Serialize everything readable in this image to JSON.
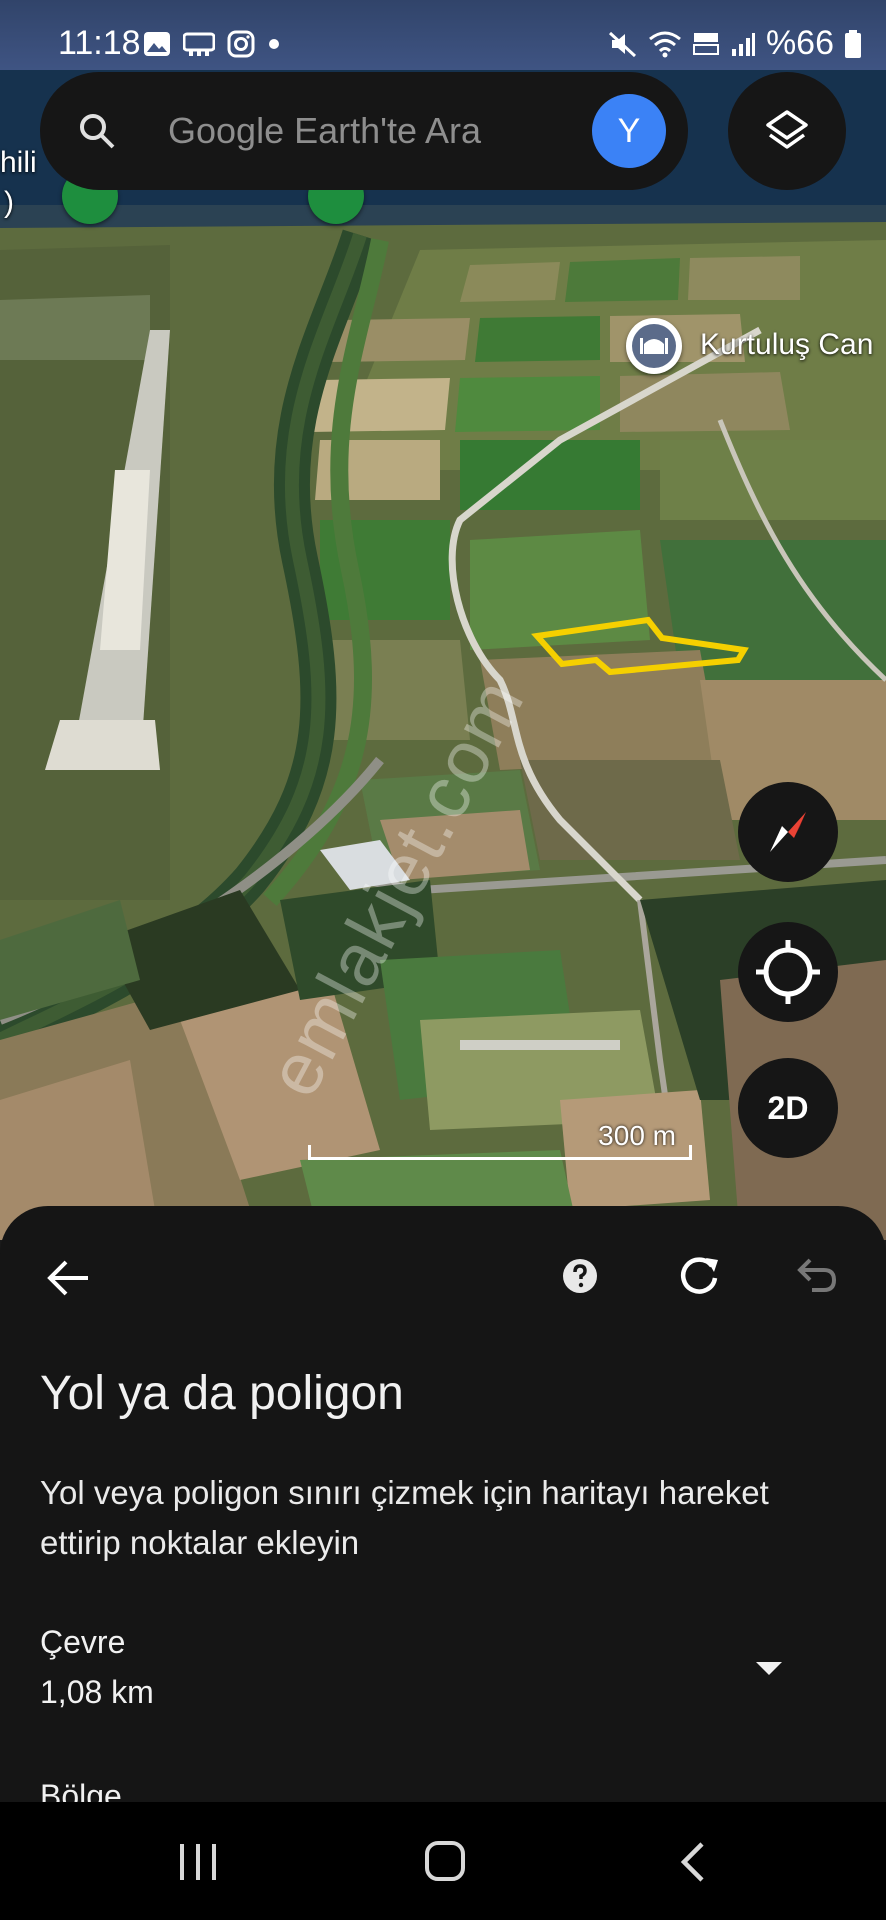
{
  "status_bar": {
    "time": "11:18",
    "battery": "%66",
    "icons": [
      "gallery-icon",
      "chat-icon",
      "instagram-icon",
      "dot-icon",
      "mute-icon",
      "wifi-icon",
      "volte-icon",
      "signal-icon",
      "battery-icon"
    ]
  },
  "search": {
    "placeholder": "Google Earth'te Ara",
    "avatar_letter": "Y"
  },
  "map": {
    "labels": {
      "left_partial_1": "hili",
      "left_partial_2": ")",
      "place": "Kurtuluş Can"
    },
    "scale_label": "300 m",
    "watermark": "emlakjet.com",
    "polygon_color": "#f5d000"
  },
  "controls": {
    "mode_toggle": "2D"
  },
  "sheet": {
    "title": "Yol ya da poligon",
    "description": "Yol veya poligon sınırı çizmek için haritayı hareket ettirip noktalar ekleyin",
    "perimeter_label": "Çevre",
    "perimeter_value": "1,08 km",
    "area_label": "Bölge"
  },
  "colors": {
    "accent": "#3b82f6",
    "sheet_bg": "#151515"
  }
}
